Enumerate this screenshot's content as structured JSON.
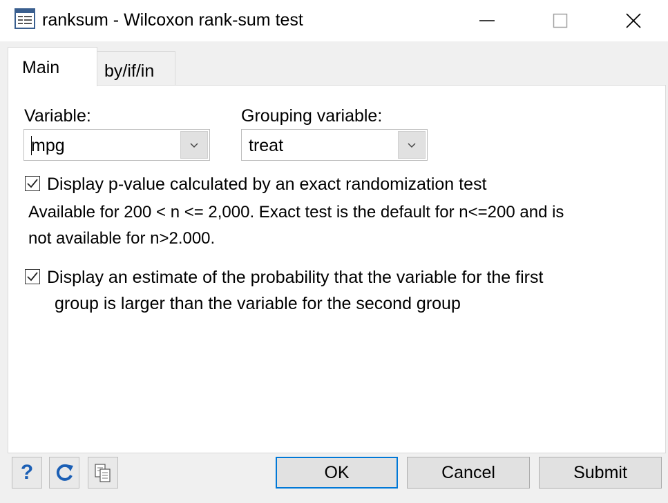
{
  "window": {
    "title": "ranksum - Wilcoxon rank-sum test",
    "icon": "dialog-icon",
    "controls": [
      "minimize-icon",
      "maximize-icon",
      "close-icon"
    ]
  },
  "tabs": [
    {
      "label": "Main",
      "active": true
    },
    {
      "label": "by/if/in",
      "active": false
    }
  ],
  "main": {
    "variable_label": "Variable:",
    "variable_value": "mpg",
    "grouping_label": "Grouping variable:",
    "grouping_value": "treat",
    "exact_checkbox": {
      "checked": true,
      "label": "Display p-value calculated by an exact randomization test",
      "note_line1": "Available for 200 < n <= 2,000.  Exact test is the default for n<=200 and is",
      "note_line2": "not available for n>2.000."
    },
    "porder_checkbox": {
      "checked": true,
      "label_line1": "Display an estimate of the probability that the variable for the first",
      "label_line2": "group is larger than the variable for the second group"
    }
  },
  "footer": {
    "icons": [
      "help-icon",
      "reset-icon",
      "copy-command-icon"
    ],
    "help_glyph": "?",
    "ok_label": "OK",
    "cancel_label": "Cancel",
    "submit_label": "Submit"
  },
  "colors": {
    "accent": "#0078d7",
    "help_blue": "#1b5fb5"
  }
}
